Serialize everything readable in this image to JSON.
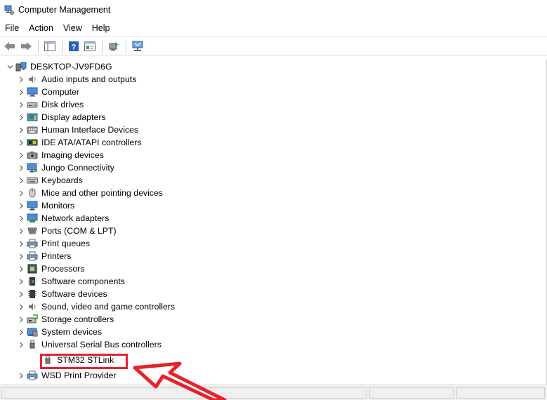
{
  "window": {
    "title": "Computer Management",
    "icon": "computer-management-icon"
  },
  "menu": [
    "File",
    "Action",
    "View",
    "Help"
  ],
  "toolbar": {
    "buttons": [
      "back-arrow-icon",
      "forward-arrow-icon",
      "show-hide-tree-icon",
      "help-icon",
      "properties-icon",
      "update-driver-icon",
      "scan-hardware-icon"
    ]
  },
  "tree": {
    "root": "DESKTOP-JV9FD6G",
    "categories": [
      {
        "label": "Audio inputs and outputs",
        "icon": "speaker-icon"
      },
      {
        "label": "Computer",
        "icon": "monitor-icon"
      },
      {
        "label": "Disk drives",
        "icon": "disk-drive-icon"
      },
      {
        "label": "Display adapters",
        "icon": "display-adapter-icon"
      },
      {
        "label": "Human Interface Devices",
        "icon": "hid-icon"
      },
      {
        "label": "IDE ATA/ATAPI controllers",
        "icon": "ide-controller-icon"
      },
      {
        "label": "Imaging devices",
        "icon": "camera-icon"
      },
      {
        "label": "Jungo Connectivity",
        "icon": "network-monitor-icon"
      },
      {
        "label": "Keyboards",
        "icon": "keyboard-icon"
      },
      {
        "label": "Mice and other pointing devices",
        "icon": "mouse-icon"
      },
      {
        "label": "Monitors",
        "icon": "monitor-icon"
      },
      {
        "label": "Network adapters",
        "icon": "network-adapter-icon"
      },
      {
        "label": "Ports (COM & LPT)",
        "icon": "port-icon"
      },
      {
        "label": "Print queues",
        "icon": "printer-icon"
      },
      {
        "label": "Printers",
        "icon": "printer-icon"
      },
      {
        "label": "Processors",
        "icon": "processor-icon"
      },
      {
        "label": "Software components",
        "icon": "software-component-icon"
      },
      {
        "label": "Software devices",
        "icon": "software-device-icon"
      },
      {
        "label": "Sound, video and game controllers",
        "icon": "speaker-icon"
      },
      {
        "label": "Storage controllers",
        "icon": "storage-controller-icon"
      },
      {
        "label": "System devices",
        "icon": "system-devices-icon"
      },
      {
        "label": "Universal Serial Bus controllers",
        "icon": "usb-icon"
      }
    ],
    "highlighted_child": {
      "label": "STM32 STLink",
      "icon": "usb-device-icon"
    },
    "last_category": {
      "label": "WSD Print Provider",
      "icon": "printer-icon"
    }
  },
  "annotation": {
    "color": "#e8222a"
  }
}
